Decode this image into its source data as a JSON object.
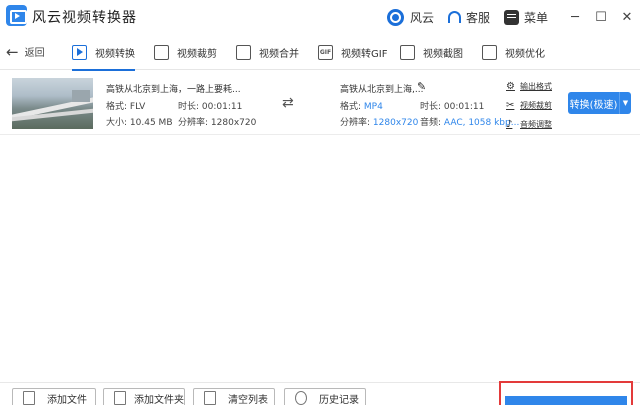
{
  "titlebar": {
    "app_title": "风云视频转换器",
    "fengyun_label": "风云",
    "service_label": "客服",
    "menu_label": "菜单"
  },
  "nav": {
    "back_label": "返回",
    "tabs": [
      {
        "label": "视频转换",
        "active": true
      },
      {
        "label": "视频裁剪"
      },
      {
        "label": "视频合并"
      },
      {
        "label": "视频转GIF"
      },
      {
        "label": "视频截图"
      },
      {
        "label": "视频优化"
      }
    ]
  },
  "file": {
    "source": {
      "name": "高铁从北京到上海，一路上要耗...",
      "format_label": "格式:",
      "format": "FLV",
      "duration_label": "时长:",
      "duration": "00:01:11",
      "size_label": "大小:",
      "size": "10.45 MB",
      "resolution_label": "分辨率:",
      "resolution": "1280x720"
    },
    "output": {
      "name": "高铁从北京到上海,...",
      "format_label": "格式:",
      "format": "MP4",
      "duration_label": "时长:",
      "duration": "00:01:11",
      "resolution_label": "分辨率:",
      "resolution": "1280x720",
      "audio_label": "音频:",
      "audio": "AAC, 1058 kbp..."
    },
    "options": {
      "output_format": "输出格式",
      "video_cut": "视频裁剪",
      "audio_adjust": "音频调整"
    },
    "convert_label": "转换(极速)"
  },
  "bottom": {
    "add_file": "添加文件",
    "add_folder": "添加文件夹",
    "clear_list": "清空列表",
    "history": "历史记录"
  },
  "colors": {
    "accent": "#2f86ea",
    "highlight_border": "#e33a3a"
  }
}
